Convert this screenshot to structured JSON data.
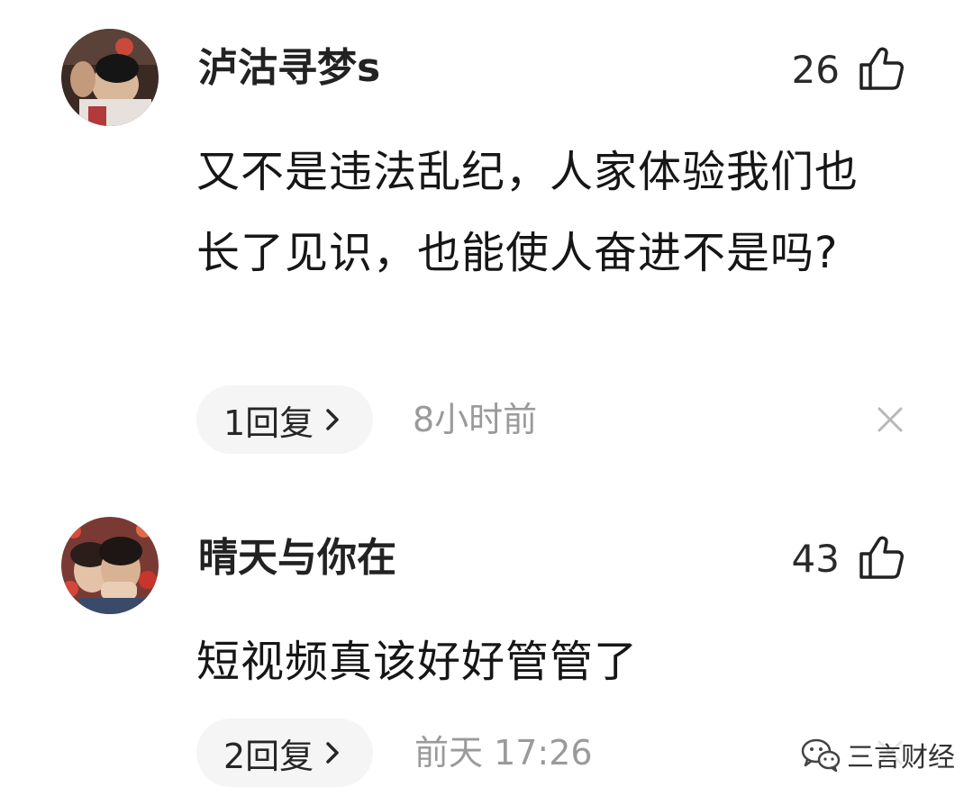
{
  "comments": [
    {
      "username": "泸沽寻梦s",
      "likes": "26",
      "content": "又不是违法乱纪，人家体验我们也长了见识，也能使人奋进不是吗?",
      "replies": "1回复",
      "time": "8小时前",
      "avatar_icon": "user-avatar-photo",
      "like_icon": "thumbs-up-icon"
    },
    {
      "username": "晴天与你在",
      "likes": "43",
      "content": "短视频真该好好管管了",
      "replies": "2回复",
      "time": "前天  17:26",
      "avatar_icon": "user-avatar-photo",
      "like_icon": "thumbs-up-icon"
    }
  ],
  "watermark": {
    "text": "三言财经",
    "icon": "wechat-icon"
  },
  "colors": {
    "background": "#ffffff",
    "pill": "#f5f5f5",
    "muted_text": "#9a9a9a",
    "primary_text": "#1a1a1a"
  }
}
